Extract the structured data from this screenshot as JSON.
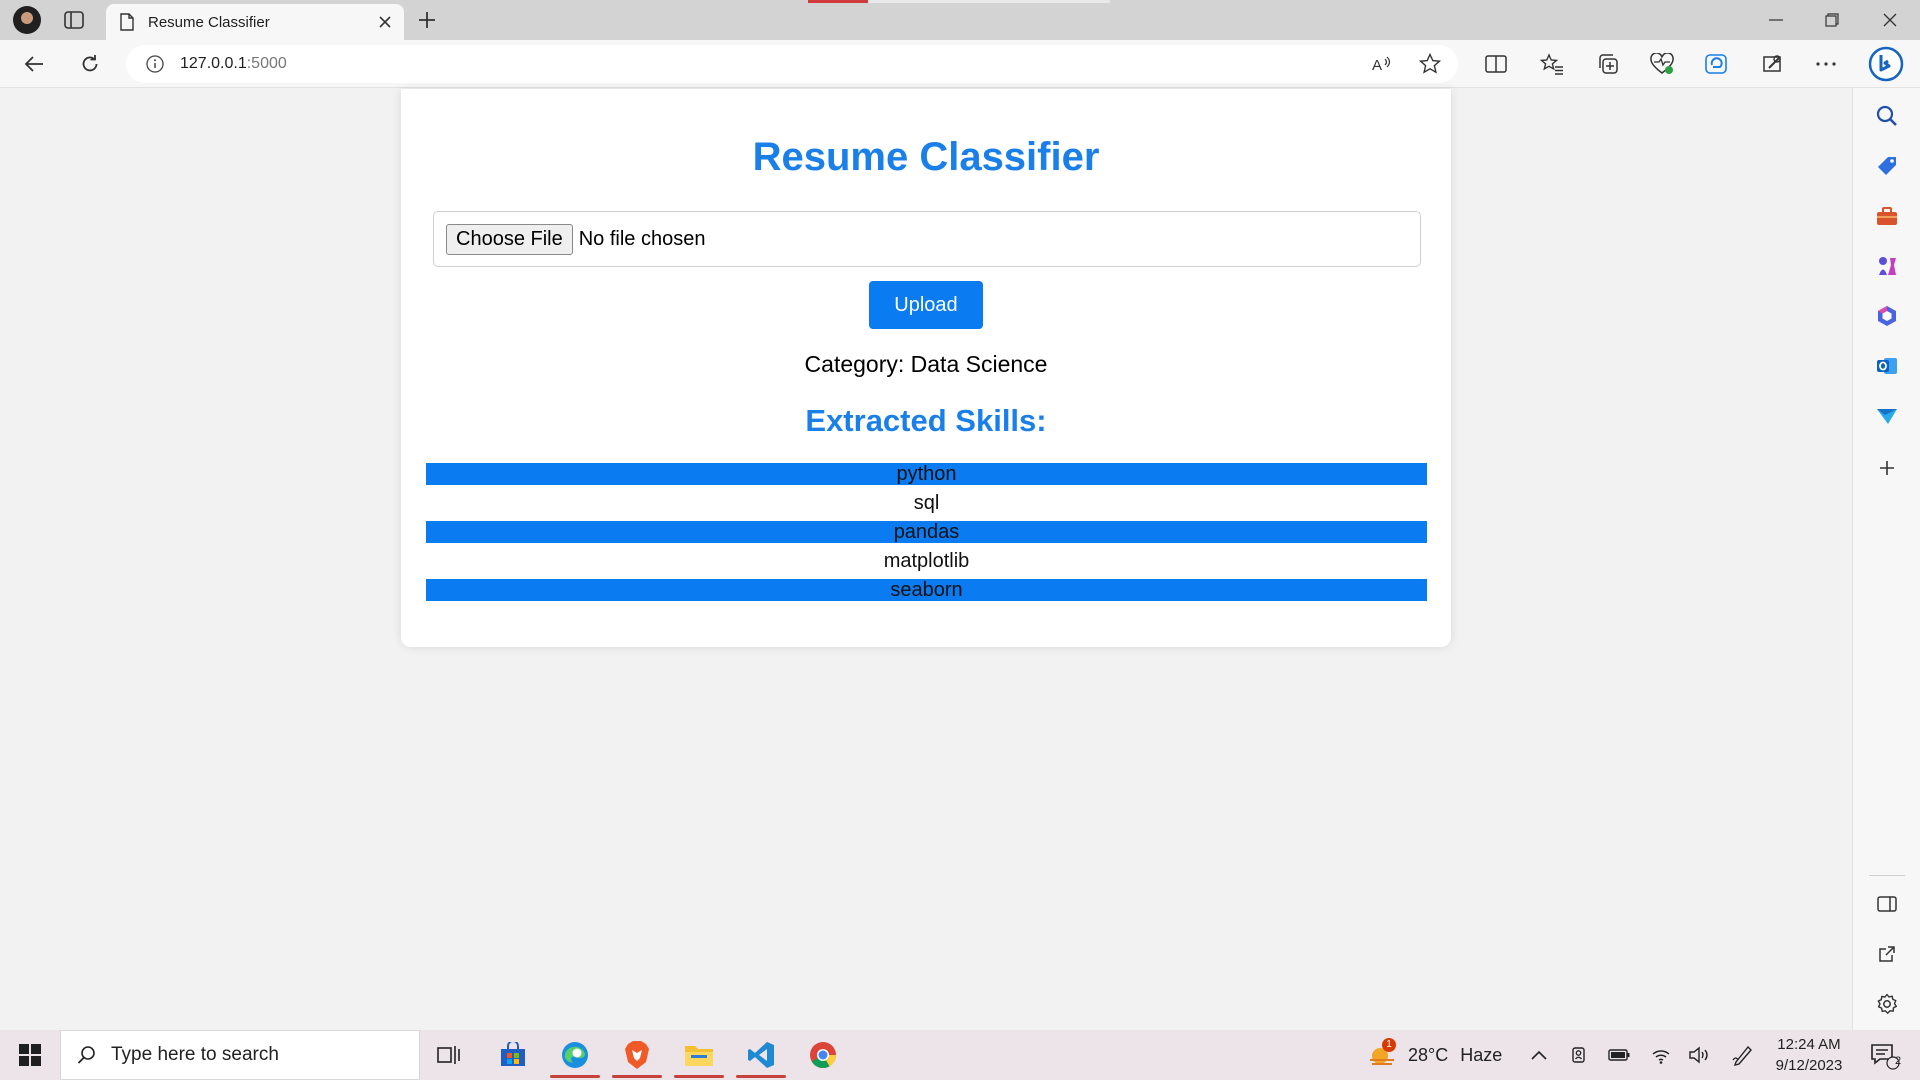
{
  "browser": {
    "tab_title": "Resume Classifier",
    "url_host": "127.0.0.1",
    "url_port": ":5000"
  },
  "page": {
    "title": "Resume Classifier",
    "choose_file_label": "Choose File",
    "file_status": "No file chosen",
    "upload_label": "Upload",
    "category_line": "Category: Data Science",
    "skills_heading": "Extracted Skills:",
    "skills": [
      "python",
      "sql",
      "pandas",
      "matplotlib",
      "seaborn"
    ]
  },
  "taskbar": {
    "search_placeholder": "Type here to search",
    "weather_temp": "28°C",
    "weather_condition": "Haze",
    "weather_badge": "1",
    "time": "12:24 AM",
    "date": "9/12/2023",
    "notification_count": "2"
  },
  "colors": {
    "accent_blue": "#1a7fe8",
    "button_blue": "#0a7bf0"
  }
}
